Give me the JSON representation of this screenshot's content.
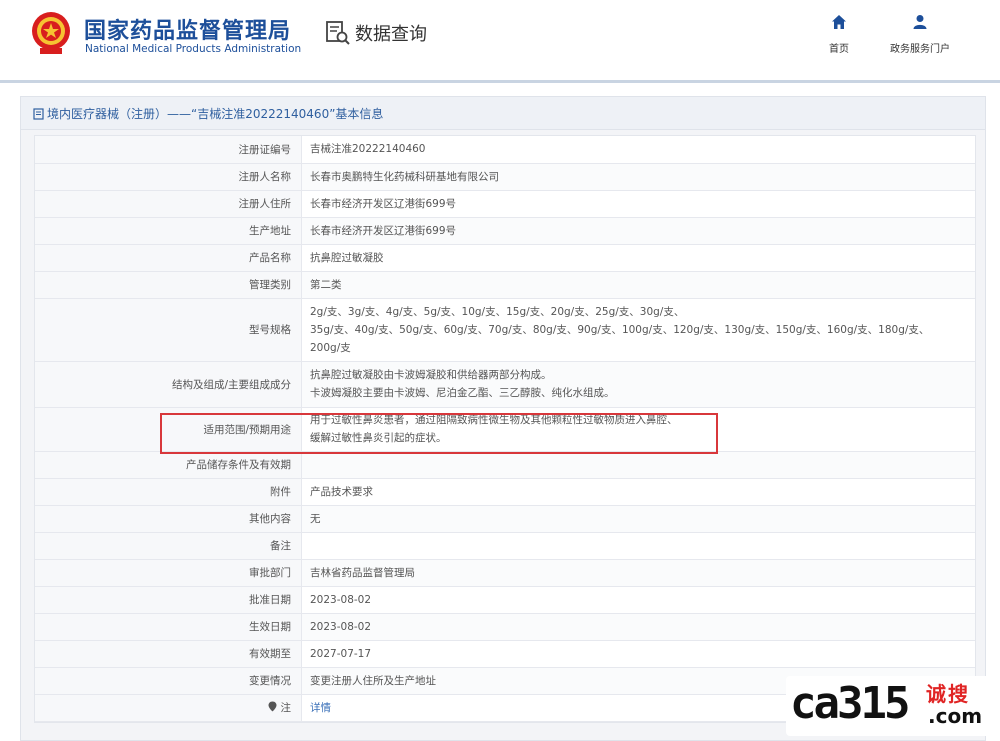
{
  "header": {
    "title_cn": "国家药品监督管理局",
    "title_en": "National Medical Products Administration",
    "query_label": "数据查询",
    "nav": [
      {
        "label": "首页",
        "icon": "home-icon"
      },
      {
        "label": "政务服务门户",
        "icon": "user-icon"
      }
    ]
  },
  "breadcrumb": {
    "text": "境内医疗器械（注册）——“吉械注准20222140460”基本信息"
  },
  "rows": [
    {
      "key": "注册证编号",
      "value": "吉械注准20222140460"
    },
    {
      "key": "注册人名称",
      "value": "长春市奥鹏特生化药械科研基地有限公司"
    },
    {
      "key": "注册人住所",
      "value": "长春市经济开发区辽港街699号"
    },
    {
      "key": "生产地址",
      "value": "长春市经济开发区辽港街699号"
    },
    {
      "key": "产品名称",
      "value": "抗鼻腔过敏凝胶"
    },
    {
      "key": "管理类别",
      "value": "第二类"
    },
    {
      "key": "型号规格",
      "lines": [
        "2g/支、3g/支、4g/支、5g/支、10g/支、15g/支、20g/支、25g/支、30g/支、",
        "35g/支、40g/支、50g/支、60g/支、70g/支、80g/支、90g/支、100g/支、120g/支、130g/支、150g/支、160g/支、180g/支、",
        "200g/支"
      ]
    },
    {
      "key": "结构及组成/主要组成成分",
      "lines": [
        "抗鼻腔过敏凝胶由卡波姆凝胶和供给器两部分构成。",
        "卡波姆凝胶主要由卡波姆、尼泊金乙酯、三乙醇胺、纯化水组成。"
      ]
    },
    {
      "key": "适用范围/预期用途",
      "lines": [
        "用于过敏性鼻炎患者，通过阻隔致病性微生物及其他颗粒性过敏物质进入鼻腔、",
        "缓解过敏性鼻炎引起的症状。"
      ]
    },
    {
      "key": "产品储存条件及有效期",
      "value": ""
    },
    {
      "key": "附件",
      "value": "产品技术要求"
    },
    {
      "key": "其他内容",
      "value": "无"
    },
    {
      "key": "备注",
      "value": ""
    },
    {
      "key": "审批部门",
      "value": "吉林省药品监督管理局"
    },
    {
      "key": "批准日期",
      "value": "2023-08-02"
    },
    {
      "key": "生效日期",
      "value": "2023-08-02"
    },
    {
      "key": "有效期至",
      "value": "2027-07-17"
    },
    {
      "key": "变更情况",
      "value": "变更注册人住所及生产地址"
    },
    {
      "key": "注",
      "value": "详情"
    }
  ],
  "watermark": {
    "main": "ca315",
    "cn": "诚搜",
    "suffix": ".com"
  }
}
